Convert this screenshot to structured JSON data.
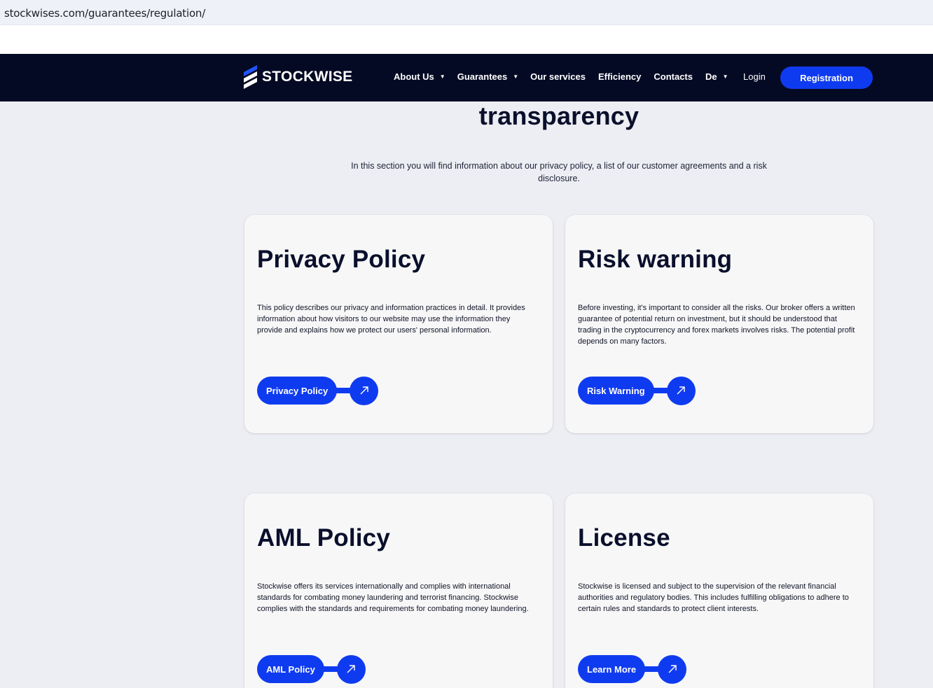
{
  "browser": {
    "url": "stockwises.com/guarantees/regulation/"
  },
  "header": {
    "brand": "STOCKWISE",
    "nav": [
      {
        "label": "About Us",
        "caret": "▼"
      },
      {
        "label": "Guarantees",
        "caret": "▼"
      },
      {
        "label": "Our services"
      },
      {
        "label": "Efficiency"
      },
      {
        "label": "Contacts"
      },
      {
        "label": "De",
        "caret": "▼"
      }
    ],
    "login": "Login",
    "register": "Registration"
  },
  "section": {
    "heading": "transparency",
    "intro": "In this section you will find information about our privacy policy, a list of our customer agreements and a risk disclosure."
  },
  "cards": [
    {
      "title": "Privacy Policy",
      "text": "This policy describes our privacy and information practices in detail. It provides information about how visitors to our website may use the information they provide and explains how we protect our users' personal information.",
      "button": "Privacy Policy"
    },
    {
      "title": "Risk warning",
      "text": "Before investing, it's important to consider all the risks. Our broker offers a written guarantee of potential return on investment, but it should be understood that trading in the cryptocurrency and forex markets involves risks. The potential profit depends on many factors.",
      "button": "Risk Warning"
    },
    {
      "title": "AML Policy",
      "text": "Stockwise offers its services internationally and complies with international standards for combating money laundering and terrorist financing. Stockwise complies with the standards and requirements for combating money laundering.",
      "button": "AML Policy"
    },
    {
      "title": "License",
      "text": "Stockwise is licensed and subject to the supervision of the relevant financial authorities and regulatory bodies. This includes fulfilling obligations to adhere to certain rules and standards to protect client interests.",
      "button": "Learn More"
    }
  ],
  "colors": {
    "navbar": "#050a24",
    "accent": "#0f3bf0",
    "page_bg": "#edeef3"
  },
  "icons": {
    "card_button_icon": "arrow-up-right-icon",
    "logo_icon": "stockwise-logo-icon"
  }
}
